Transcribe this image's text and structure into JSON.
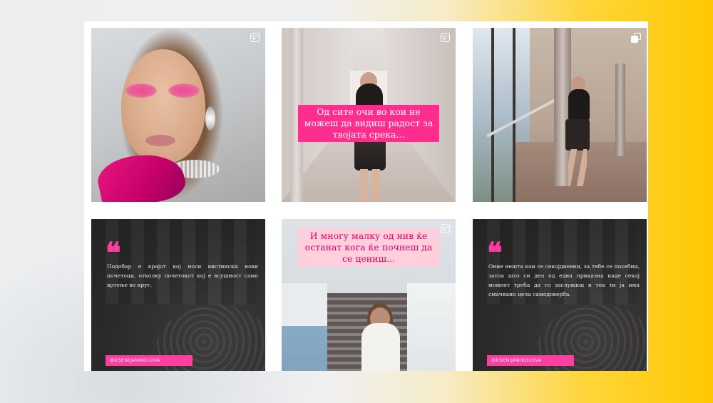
{
  "grid": {
    "tiles": [
      {
        "id": "tile-1",
        "type_icon": "reel-icon"
      },
      {
        "id": "tile-2",
        "type_icon": "reel-icon",
        "caption": "Од сите очи во кои не можеш да видиш радост за твојата срека..."
      },
      {
        "id": "tile-3",
        "type_icon": "carousel-icon"
      },
      {
        "id": "tile-4",
        "quote_mark": "❝",
        "quote": "Подобар е крајот кој носи вистински нови почетоци, отколку почетокот кој е всушност само вртење во круг.",
        "handle": "@KSENIJANIKOLOVA"
      },
      {
        "id": "tile-5",
        "type_icon": "reel-icon",
        "caption": "И многу малку од нив ќе останат кога ќе почнеш да се цениш..."
      },
      {
        "id": "tile-6",
        "quote_mark": "❝",
        "quote": "Оние нешта кои се секојдневни, за тебе се посебни, затоа што си дел од една приказна каде секој момент треба да го заслужиш и тоа ти ја има смачкано цела самодоверба.",
        "handle": "@KSENIJANIKOLOVA"
      }
    ]
  },
  "colors": {
    "accent_pink": "#ff2d8e",
    "caption_pink_light": "#ffd0dc",
    "quote_background": "#2b2a2a",
    "backdrop_yellow": "#ffc800"
  }
}
